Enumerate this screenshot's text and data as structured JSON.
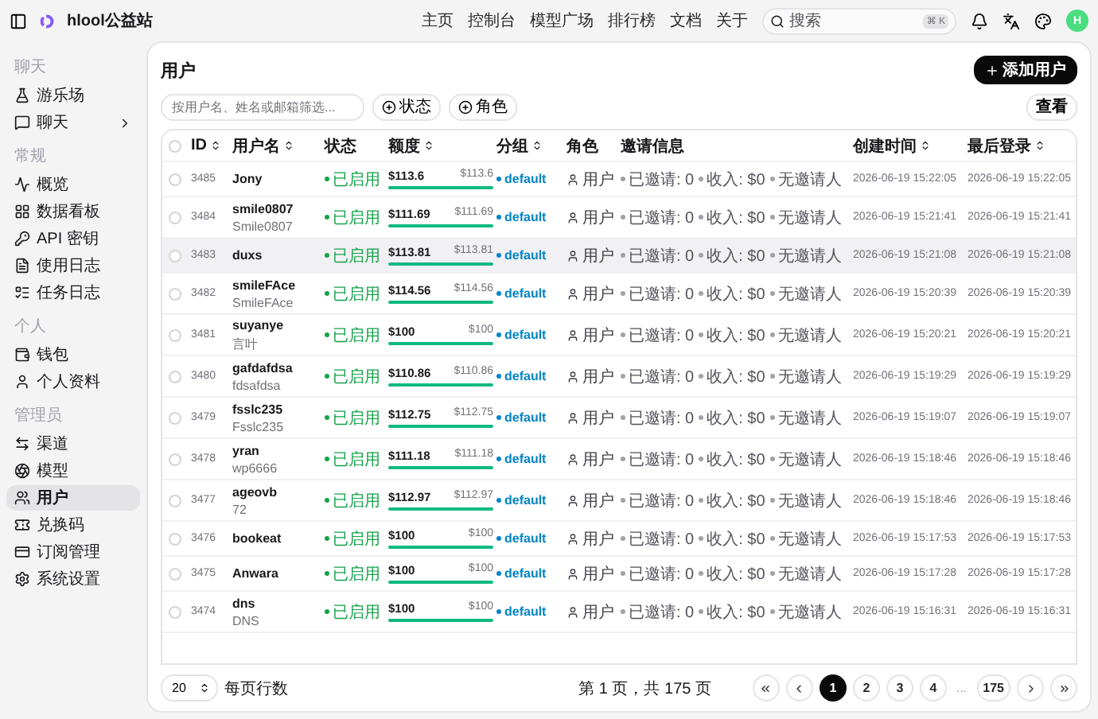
{
  "brand": {
    "name": "hlool公益站"
  },
  "nav": [
    {
      "label": "主页"
    },
    {
      "label": "控制台"
    },
    {
      "label": "模型广场"
    },
    {
      "label": "排行榜"
    },
    {
      "label": "文档"
    },
    {
      "label": "关于"
    }
  ],
  "search": {
    "placeholder": "搜索",
    "shortcut": "⌘ K"
  },
  "avatar": {
    "initial": "H"
  },
  "sidebar": [
    {
      "title": "聊天",
      "items": [
        {
          "label": "游乐场",
          "selected": false,
          "expandable": false
        },
        {
          "label": "聊天",
          "selected": false,
          "expandable": true
        }
      ]
    },
    {
      "title": "常规",
      "items": [
        {
          "label": "概览",
          "selected": false,
          "expandable": false
        },
        {
          "label": "数据看板",
          "selected": false,
          "expandable": false
        },
        {
          "label": "API 密钥",
          "selected": false,
          "expandable": false
        },
        {
          "label": "使用日志",
          "selected": false,
          "expandable": false
        },
        {
          "label": "任务日志",
          "selected": false,
          "expandable": false
        }
      ]
    },
    {
      "title": "个人",
      "items": [
        {
          "label": "钱包",
          "selected": false,
          "expandable": false
        },
        {
          "label": "个人资料",
          "selected": false,
          "expandable": false
        }
      ]
    },
    {
      "title": "管理员",
      "items": [
        {
          "label": "渠道",
          "selected": false,
          "expandable": false
        },
        {
          "label": "模型",
          "selected": false,
          "expandable": false
        },
        {
          "label": "用户",
          "selected": true,
          "expandable": false
        },
        {
          "label": "兑换码",
          "selected": false,
          "expandable": false
        },
        {
          "label": "订阅管理",
          "selected": false,
          "expandable": false
        },
        {
          "label": "系统设置",
          "selected": false,
          "expandable": false
        }
      ]
    }
  ],
  "page": {
    "title": "用户",
    "add_button": "添加用户",
    "filter_placeholder": "按用户名、姓名或邮箱筛选...",
    "filters": [
      "状态",
      "角色"
    ],
    "view_button": "查看"
  },
  "table": {
    "all_selected": false,
    "columns": [
      {
        "label": "ID",
        "sortable": true
      },
      {
        "label": "用户名",
        "sortable": true
      },
      {
        "label": "状态",
        "sortable": false
      },
      {
        "label": "额度",
        "sortable": true
      },
      {
        "label": "分组",
        "sortable": true
      },
      {
        "label": "角色",
        "sortable": false
      },
      {
        "label": "邀请信息",
        "sortable": false
      },
      {
        "label": "创建时间",
        "sortable": true
      },
      {
        "label": "最后登录",
        "sortable": true
      }
    ],
    "rows": [
      {
        "id": "3485",
        "username": "Jony",
        "status": "已启用",
        "quota_used": "$113.6",
        "quota_total": "$113.6",
        "level": 1,
        "group": "default",
        "role": "用户",
        "invited": "已邀请: 0",
        "income": "收入: $0",
        "inviter": "无邀请人",
        "created": "2026-06-19 15:22:05",
        "last_login": "2026-06-19 15:22:05",
        "selected": false,
        "highlighted": false
      },
      {
        "id": "3484",
        "username": "smile0807",
        "display_name": "Smile0807",
        "status": "已启用",
        "quota_used": "$111.69",
        "quota_total": "$111.69",
        "level": 1,
        "group": "default",
        "role": "用户",
        "invited": "已邀请: 0",
        "income": "收入: $0",
        "inviter": "无邀请人",
        "created": "2026-06-19 15:21:41",
        "last_login": "2026-06-19 15:21:41",
        "selected": false,
        "highlighted": false
      },
      {
        "id": "3483",
        "username": "duxs",
        "status": "已启用",
        "quota_used": "$113.81",
        "quota_total": "$113.81",
        "level": 1,
        "group": "default",
        "role": "用户",
        "invited": "已邀请: 0",
        "income": "收入: $0",
        "inviter": "无邀请人",
        "created": "2026-06-19 15:21:08",
        "last_login": "2026-06-19 15:21:08",
        "selected": false,
        "highlighted": true
      },
      {
        "id": "3482",
        "username": "smileFAce",
        "display_name": "SmileFAce",
        "status": "已启用",
        "quota_used": "$114.56",
        "quota_total": "$114.56",
        "level": 1,
        "group": "default",
        "role": "用户",
        "invited": "已邀请: 0",
        "income": "收入: $0",
        "inviter": "无邀请人",
        "created": "2026-06-19 15:20:39",
        "last_login": "2026-06-19 15:20:39",
        "selected": false,
        "highlighted": false
      },
      {
        "id": "3481",
        "username": "suyanye",
        "display_name": "言叶",
        "status": "已启用",
        "quota_used": "$100",
        "quota_total": "$100",
        "level": 1,
        "group": "default",
        "role": "用户",
        "invited": "已邀请: 0",
        "income": "收入: $0",
        "inviter": "无邀请人",
        "created": "2026-06-19 15:20:21",
        "last_login": "2026-06-19 15:20:21",
        "selected": false,
        "highlighted": false
      },
      {
        "id": "3480",
        "username": "gafdafdsa",
        "display_name": "fdsafdsa",
        "status": "已启用",
        "quota_used": "$110.86",
        "quota_total": "$110.86",
        "level": 1,
        "group": "default",
        "role": "用户",
        "invited": "已邀请: 0",
        "income": "收入: $0",
        "inviter": "无邀请人",
        "created": "2026-06-19 15:19:29",
        "last_login": "2026-06-19 15:19:29",
        "selected": false,
        "highlighted": false
      },
      {
        "id": "3479",
        "username": "fsslc235",
        "display_name": "Fsslc235",
        "status": "已启用",
        "quota_used": "$112.75",
        "quota_total": "$112.75",
        "level": 1,
        "group": "default",
        "role": "用户",
        "invited": "已邀请: 0",
        "income": "收入: $0",
        "inviter": "无邀请人",
        "created": "2026-06-19 15:19:07",
        "last_login": "2026-06-19 15:19:07",
        "selected": false,
        "highlighted": false
      },
      {
        "id": "3478",
        "username": "yran",
        "display_name": "wp6666",
        "status": "已启用",
        "quota_used": "$111.18",
        "quota_total": "$111.18",
        "level": 1,
        "group": "default",
        "role": "用户",
        "invited": "已邀请: 0",
        "income": "收入: $0",
        "inviter": "无邀请人",
        "created": "2026-06-19 15:18:46",
        "last_login": "2026-06-19 15:18:46",
        "selected": false,
        "highlighted": false
      },
      {
        "id": "3477",
        "username": "ageovb",
        "display_name": "72",
        "status": "已启用",
        "quota_used": "$112.97",
        "quota_total": "$112.97",
        "level": 1,
        "group": "default",
        "role": "用户",
        "invited": "已邀请: 0",
        "income": "收入: $0",
        "inviter": "无邀请人",
        "created": "2026-06-19 15:18:46",
        "last_login": "2026-06-19 15:18:46",
        "selected": false,
        "highlighted": false
      },
      {
        "id": "3476",
        "username": "bookeat",
        "status": "已启用",
        "quota_used": "$100",
        "quota_total": "$100",
        "level": 1,
        "group": "default",
        "role": "用户",
        "invited": "已邀请: 0",
        "income": "收入: $0",
        "inviter": "无邀请人",
        "created": "2026-06-19 15:17:53",
        "last_login": "2026-06-19 15:17:53",
        "selected": false,
        "highlighted": false
      },
      {
        "id": "3475",
        "username": "Anwara",
        "status": "已启用",
        "quota_used": "$100",
        "quota_total": "$100",
        "level": 1,
        "group": "default",
        "role": "用户",
        "invited": "已邀请: 0",
        "income": "收入: $0",
        "inviter": "无邀请人",
        "created": "2026-06-19 15:17:28",
        "last_login": "2026-06-19 15:17:28",
        "selected": false,
        "highlighted": false
      },
      {
        "id": "3474",
        "username": "dns",
        "display_name": "DNS",
        "status": "已启用",
        "quota_used": "$100",
        "quota_total": "$100",
        "level": 1,
        "group": "default",
        "role": "用户",
        "invited": "已邀请: 0",
        "income": "收入: $0",
        "inviter": "无邀请人",
        "created": "2026-06-19 15:16:31",
        "last_login": "2026-06-19 15:16:31",
        "selected": false,
        "highlighted": false
      }
    ]
  },
  "footer": {
    "page_size": "20",
    "page_size_label": "每页行数",
    "page_info": "第 1 页，共 175 页",
    "pages": [
      {
        "label": "1",
        "selected": true
      },
      {
        "label": "2",
        "selected": false
      },
      {
        "label": "3",
        "selected": false
      },
      {
        "label": "4",
        "selected": false
      },
      {
        "label": "...",
        "selected": false
      },
      {
        "label": "175",
        "selected": false
      }
    ]
  }
}
